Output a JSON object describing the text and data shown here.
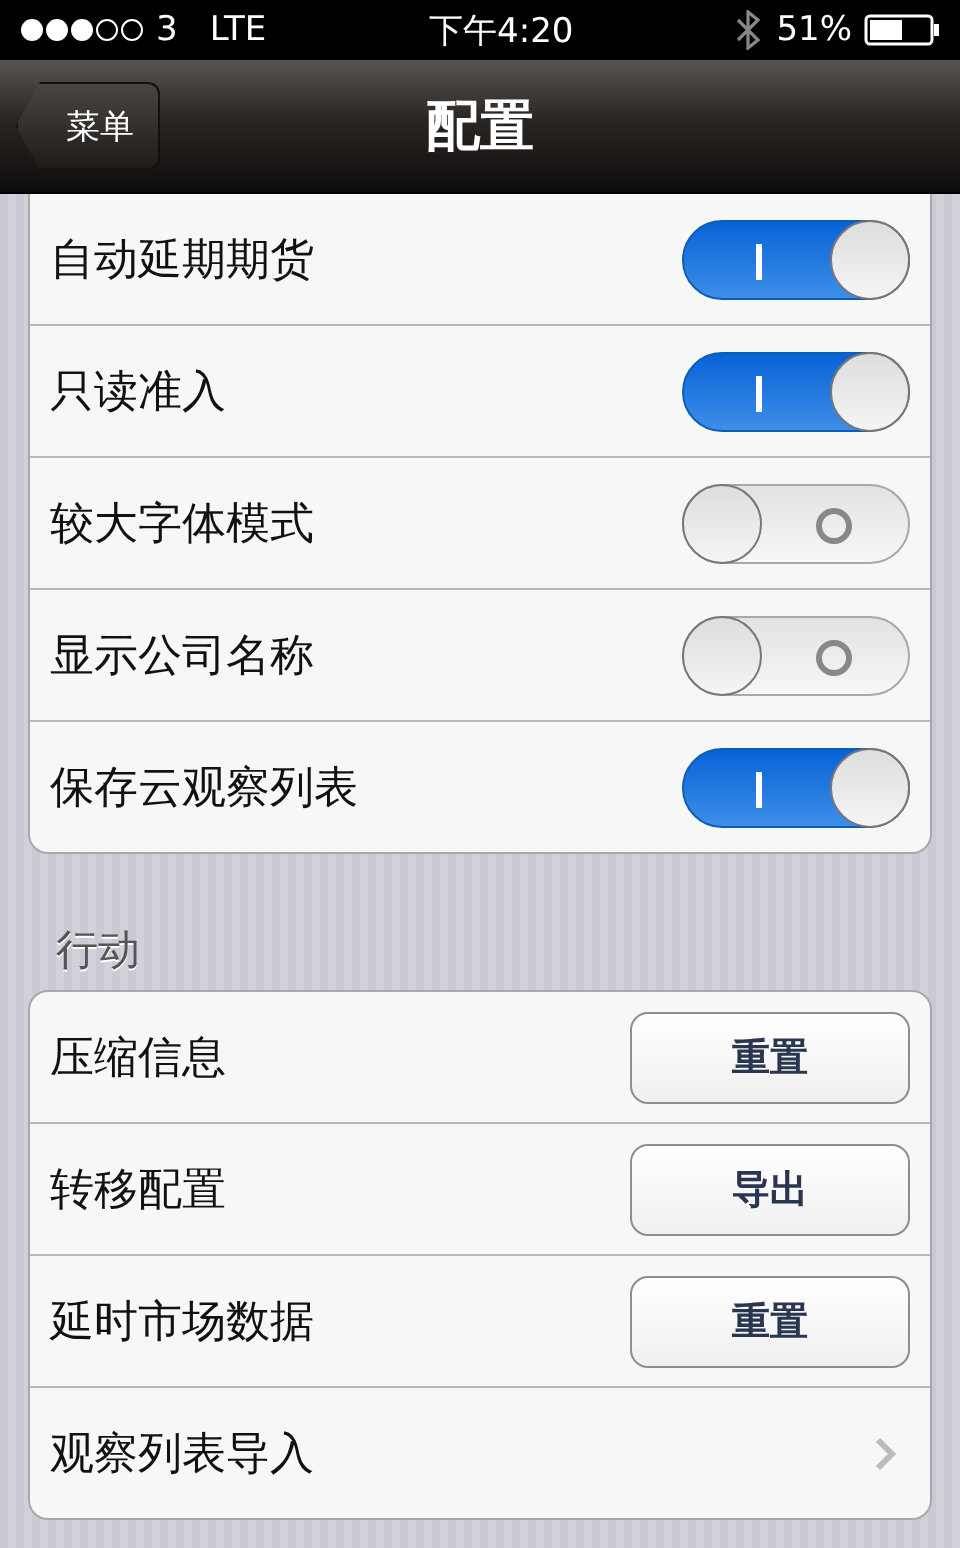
{
  "status_bar": {
    "carrier": "3",
    "network": "LTE",
    "time": "下午4:20",
    "battery_percent": "51%"
  },
  "nav_bar": {
    "back_button": "菜单",
    "title": "配置"
  },
  "settings_group": {
    "rows": [
      {
        "label": "自动延期期货",
        "on": true
      },
      {
        "label": "只读准入",
        "on": true
      },
      {
        "label": "较大字体模式",
        "on": false
      },
      {
        "label": "显示公司名称",
        "on": false
      },
      {
        "label": "保存云观察列表",
        "on": true
      }
    ]
  },
  "actions_group": {
    "header": "行动",
    "rows": [
      {
        "kind": "button",
        "label": "压缩信息",
        "button": "重置"
      },
      {
        "kind": "button",
        "label": "转移配置",
        "button": "导出"
      },
      {
        "kind": "button",
        "label": "延时市场数据",
        "button": "重置"
      },
      {
        "kind": "link",
        "label": "观察列表导入"
      }
    ]
  }
}
